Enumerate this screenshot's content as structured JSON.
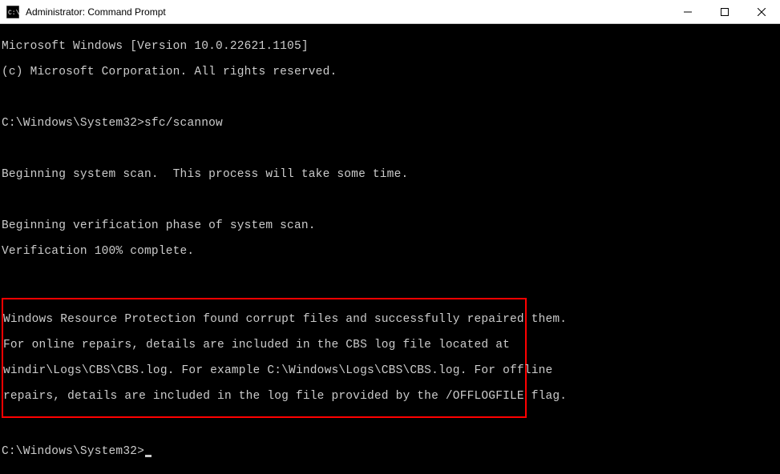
{
  "titlebar": {
    "title": "Administrator: Command Prompt"
  },
  "terminal": {
    "line1": "Microsoft Windows [Version 10.0.22621.1105]",
    "line2": "(c) Microsoft Corporation. All rights reserved.",
    "prompt1_path": "C:\\Windows\\System32>",
    "prompt1_cmd": "sfc/scannow",
    "line3": "Beginning system scan.  This process will take some time.",
    "line4": "Beginning verification phase of system scan.",
    "line5": "Verification 100% complete.",
    "result1": "Windows Resource Protection found corrupt files and successfully repaired them.",
    "result2": "For online repairs, details are included in the CBS log file located at",
    "result3": "windir\\Logs\\CBS\\CBS.log. For example C:\\Windows\\Logs\\CBS\\CBS.log. For offline",
    "result4": "repairs, details are included in the log file provided by the /OFFLOGFILE flag.",
    "prompt2_path": "C:\\Windows\\System32>"
  }
}
